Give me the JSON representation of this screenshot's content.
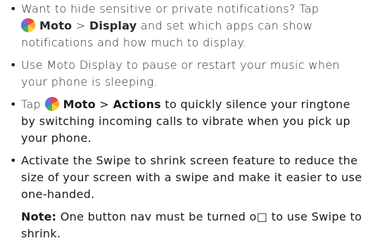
{
  "bullets": [
    {
      "marker": "•",
      "pre": "Want to hide sensitive or private notifications? Tap",
      "app": "Moto",
      "sep": ">",
      "target": "Display",
      "post": "and set which apps can show notifications and how much to display."
    },
    {
      "marker": "•",
      "text": "Use Moto Display to pause or restart your music when your phone is sleeping."
    },
    {
      "marker": "•",
      "pre": "Tap",
      "app": "Moto",
      "sep": ">",
      "target": "Actions",
      "post": "to quickly silence your ringtone by switching incoming calls to vibrate when you pick up your phone."
    },
    {
      "marker": "•",
      "text": "Activate the Swipe to shrink screen feature to reduce the size of your screen with a swipe and make it easier to use one-handed."
    }
  ],
  "note": {
    "label": "Note:",
    "text": "One button nav must be turned o□ to use Swipe to shrink."
  },
  "icon": "moto-app-icon"
}
